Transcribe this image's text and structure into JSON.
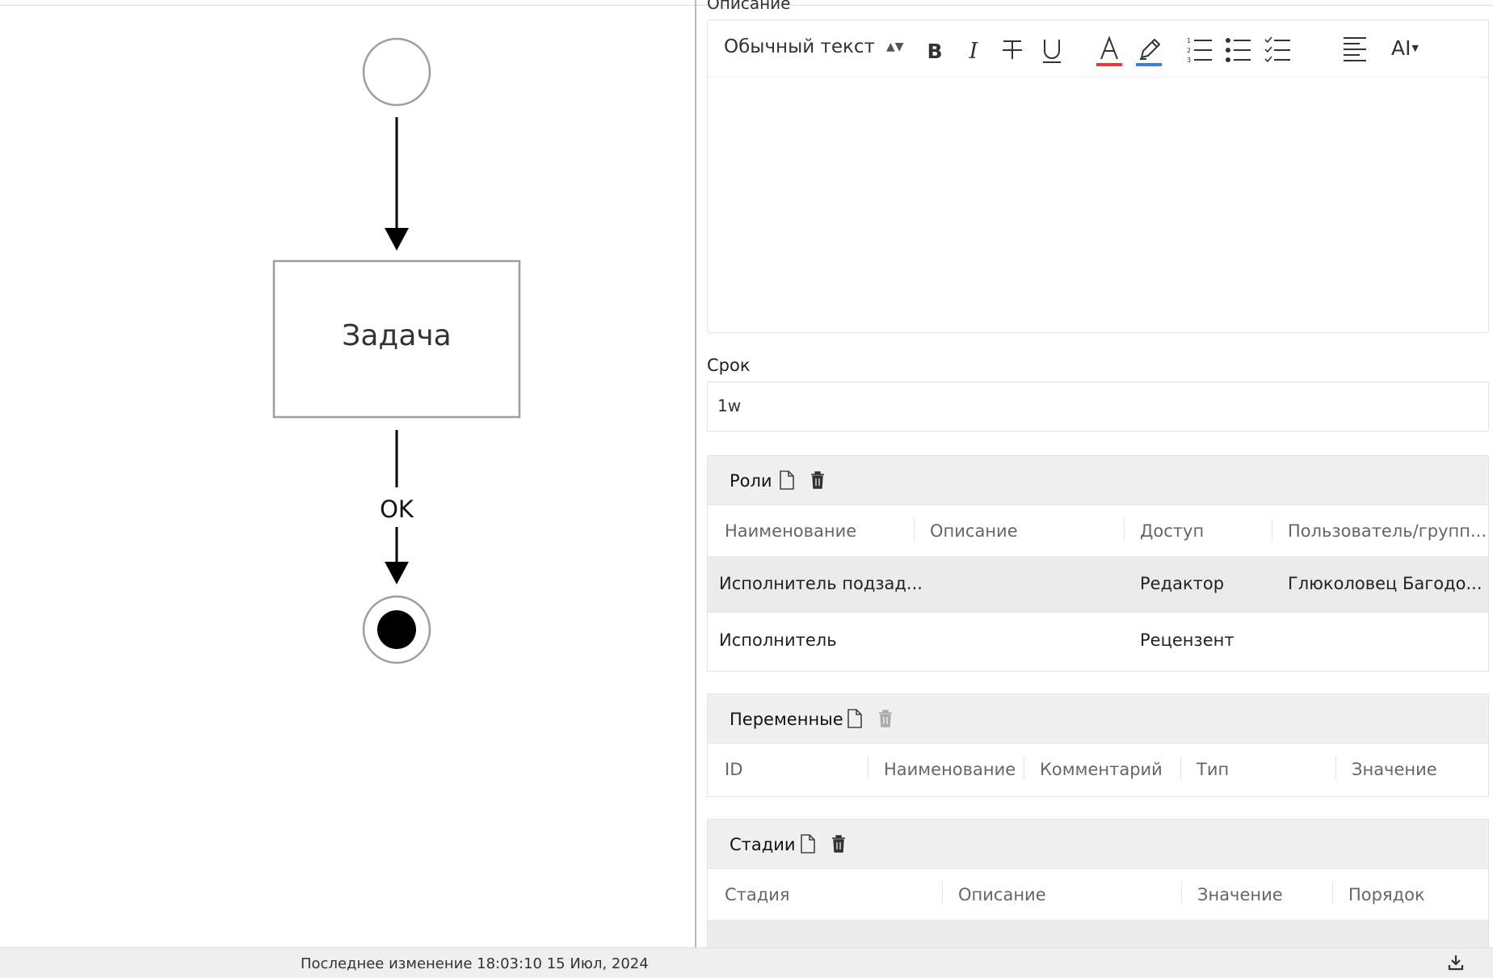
{
  "diagram": {
    "task_label": "Задача",
    "flow_label": "OK"
  },
  "description": {
    "label": "Описание",
    "style_select": "Обычный текст",
    "ai_label": "AI",
    "font_color": "#e53935",
    "highlight_color": "#3b82d6"
  },
  "deadline": {
    "label": "Срок",
    "value": "1w"
  },
  "roles": {
    "title": "Роли",
    "columns": [
      "Наименование",
      "Описание",
      "Доступ",
      "Пользователь/групп..."
    ],
    "rows": [
      [
        "Исполнитель подзад...",
        "",
        "Редактор",
        "Глюколовец Багодо..."
      ],
      [
        "Исполнитель",
        "",
        "Рецензент",
        ""
      ]
    ]
  },
  "variables": {
    "title": "Переменные",
    "columns": [
      "ID",
      "Наименование",
      "Комментарий",
      "Тип",
      "Значение"
    ]
  },
  "stages": {
    "title": "Стадии",
    "columns": [
      "Стадия",
      "Описание",
      "Значение",
      "Порядок"
    ]
  },
  "statusbar": {
    "text": "Последнее изменение 18:03:10 15 Июл, 2024"
  }
}
